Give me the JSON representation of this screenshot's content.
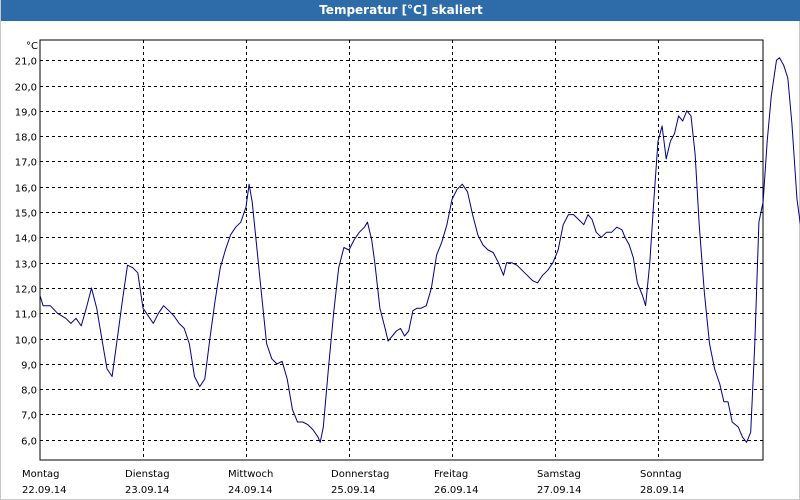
{
  "window": {
    "title": "Temperatur [°C] skaliert"
  },
  "chart_data": {
    "type": "line",
    "title": "Temperatur [°C] skaliert",
    "ylabel": "°C",
    "xlabel": "",
    "ylim": [
      5.2,
      21.8
    ],
    "grid": true,
    "y_ticks": [
      "6,0",
      "7,0",
      "8,0",
      "9,0",
      "10,0",
      "11,0",
      "12,0",
      "13,0",
      "14,0",
      "15,0",
      "16,0",
      "17,0",
      "18,0",
      "19,0",
      "20,0",
      "21,0"
    ],
    "x_day_labels": [
      {
        "day": "Montag",
        "date": "22.09.14"
      },
      {
        "day": "Dienstag",
        "date": "23.09.14"
      },
      {
        "day": "Mittwoch",
        "date": "24.09.14"
      },
      {
        "day": "Donnerstag",
        "date": "25.09.14"
      },
      {
        "day": "Freitag",
        "date": "26.09.14"
      },
      {
        "day": "Samstag",
        "date": "27.09.14"
      },
      {
        "day": "Sonntag",
        "date": "28.09.14"
      }
    ],
    "x_unit": "days since 22.09.14 00:00",
    "series": [
      {
        "color": "#00008b",
        "points": [
          [
            0.0,
            11.7
          ],
          [
            0.03,
            11.3
          ],
          [
            0.1,
            11.3
          ],
          [
            0.17,
            11.0
          ],
          [
            0.25,
            10.8
          ],
          [
            0.3,
            10.6
          ],
          [
            0.35,
            10.8
          ],
          [
            0.4,
            10.5
          ],
          [
            0.45,
            11.2
          ],
          [
            0.5,
            12.0
          ],
          [
            0.55,
            11.2
          ],
          [
            0.6,
            10.0
          ],
          [
            0.65,
            8.8
          ],
          [
            0.7,
            8.5
          ],
          [
            0.75,
            10.0
          ],
          [
            0.8,
            11.5
          ],
          [
            0.85,
            12.9
          ],
          [
            0.9,
            12.8
          ],
          [
            0.95,
            12.6
          ],
          [
            1.0,
            11.2
          ],
          [
            1.05,
            10.9
          ],
          [
            1.1,
            10.6
          ],
          [
            1.15,
            11.0
          ],
          [
            1.2,
            11.3
          ],
          [
            1.25,
            11.1
          ],
          [
            1.3,
            10.9
          ],
          [
            1.35,
            10.6
          ],
          [
            1.4,
            10.4
          ],
          [
            1.45,
            9.8
          ],
          [
            1.5,
            8.5
          ],
          [
            1.55,
            8.1
          ],
          [
            1.6,
            8.4
          ],
          [
            1.65,
            10.0
          ],
          [
            1.7,
            11.5
          ],
          [
            1.75,
            12.8
          ],
          [
            1.8,
            13.5
          ],
          [
            1.85,
            14.1
          ],
          [
            1.9,
            14.4
          ],
          [
            1.95,
            14.6
          ],
          [
            2.0,
            15.2
          ],
          [
            2.03,
            16.1
          ],
          [
            2.06,
            15.4
          ],
          [
            2.1,
            13.8
          ],
          [
            2.15,
            11.8
          ],
          [
            2.2,
            9.8
          ],
          [
            2.25,
            9.2
          ],
          [
            2.3,
            9.0
          ],
          [
            2.35,
            9.1
          ],
          [
            2.4,
            8.4
          ],
          [
            2.45,
            7.2
          ],
          [
            2.5,
            6.7
          ],
          [
            2.55,
            6.7
          ],
          [
            2.6,
            6.6
          ],
          [
            2.65,
            6.4
          ],
          [
            2.7,
            6.1
          ],
          [
            2.72,
            5.9
          ],
          [
            2.75,
            6.5
          ],
          [
            2.8,
            8.8
          ],
          [
            2.85,
            11.0
          ],
          [
            2.9,
            12.8
          ],
          [
            2.95,
            13.6
          ],
          [
            3.0,
            13.5
          ],
          [
            3.05,
            13.9
          ],
          [
            3.1,
            14.2
          ],
          [
            3.15,
            14.4
          ],
          [
            3.18,
            14.6
          ],
          [
            3.22,
            13.9
          ],
          [
            3.25,
            13.0
          ],
          [
            3.3,
            11.2
          ],
          [
            3.35,
            10.4
          ],
          [
            3.38,
            9.9
          ],
          [
            3.42,
            10.1
          ],
          [
            3.46,
            10.3
          ],
          [
            3.5,
            10.4
          ],
          [
            3.54,
            10.1
          ],
          [
            3.58,
            10.3
          ],
          [
            3.62,
            11.1
          ],
          [
            3.66,
            11.2
          ],
          [
            3.7,
            11.2
          ],
          [
            3.75,
            11.3
          ],
          [
            3.8,
            12.0
          ],
          [
            3.85,
            13.3
          ],
          [
            3.9,
            13.8
          ],
          [
            3.95,
            14.5
          ],
          [
            4.0,
            15.5
          ],
          [
            4.05,
            15.9
          ],
          [
            4.1,
            16.1
          ],
          [
            4.15,
            15.8
          ],
          [
            4.2,
            14.9
          ],
          [
            4.25,
            14.1
          ],
          [
            4.3,
            13.7
          ],
          [
            4.35,
            13.5
          ],
          [
            4.4,
            13.4
          ],
          [
            4.45,
            13.0
          ],
          [
            4.5,
            12.5
          ],
          [
            4.53,
            13.0
          ],
          [
            4.58,
            13.0
          ],
          [
            4.63,
            12.9
          ],
          [
            4.68,
            12.7
          ],
          [
            4.73,
            12.5
          ],
          [
            4.78,
            12.3
          ],
          [
            4.83,
            12.2
          ],
          [
            4.88,
            12.5
          ],
          [
            4.93,
            12.7
          ],
          [
            4.98,
            13.0
          ],
          [
            5.03,
            13.5
          ],
          [
            5.08,
            14.5
          ],
          [
            5.13,
            14.9
          ],
          [
            5.18,
            14.9
          ],
          [
            5.23,
            14.7
          ],
          [
            5.28,
            14.5
          ],
          [
            5.32,
            14.9
          ],
          [
            5.36,
            14.7
          ],
          [
            5.4,
            14.2
          ],
          [
            5.45,
            14.0
          ],
          [
            5.5,
            14.2
          ],
          [
            5.55,
            14.2
          ],
          [
            5.6,
            14.4
          ],
          [
            5.65,
            14.3
          ],
          [
            5.68,
            14.0
          ],
          [
            5.72,
            13.7
          ],
          [
            5.76,
            13.2
          ],
          [
            5.8,
            12.2
          ],
          [
            5.85,
            11.7
          ],
          [
            5.88,
            11.3
          ],
          [
            5.92,
            13.0
          ],
          [
            5.96,
            15.5
          ],
          [
            6.0,
            17.8
          ],
          [
            6.04,
            18.4
          ],
          [
            6.08,
            17.1
          ],
          [
            6.12,
            17.8
          ],
          [
            6.16,
            18.1
          ],
          [
            6.2,
            18.8
          ],
          [
            6.24,
            18.6
          ],
          [
            6.28,
            19.0
          ],
          [
            6.32,
            18.8
          ],
          [
            6.36,
            17.3
          ],
          [
            6.4,
            14.5
          ],
          [
            6.45,
            11.8
          ],
          [
            6.5,
            9.8
          ],
          [
            6.55,
            8.8
          ],
          [
            6.6,
            8.2
          ],
          [
            6.64,
            7.5
          ],
          [
            6.68,
            7.5
          ],
          [
            6.72,
            6.7
          ],
          [
            6.78,
            6.5
          ],
          [
            6.82,
            6.1
          ],
          [
            6.86,
            5.9
          ],
          [
            6.9,
            6.3
          ],
          [
            6.94,
            9.8
          ],
          [
            6.98,
            14.6
          ],
          [
            7.02,
            15.4
          ],
          [
            7.06,
            17.8
          ],
          [
            7.1,
            19.6
          ],
          [
            7.15,
            21.0
          ],
          [
            7.18,
            21.1
          ],
          [
            7.22,
            20.8
          ],
          [
            7.26,
            20.3
          ],
          [
            7.3,
            18.5
          ],
          [
            7.35,
            15.5
          ],
          [
            7.4,
            14.0
          ],
          [
            7.45,
            13.0
          ],
          [
            7.5,
            12.5
          ],
          [
            7.55,
            11.7
          ],
          [
            7.58,
            11.3
          ]
        ]
      }
    ]
  }
}
